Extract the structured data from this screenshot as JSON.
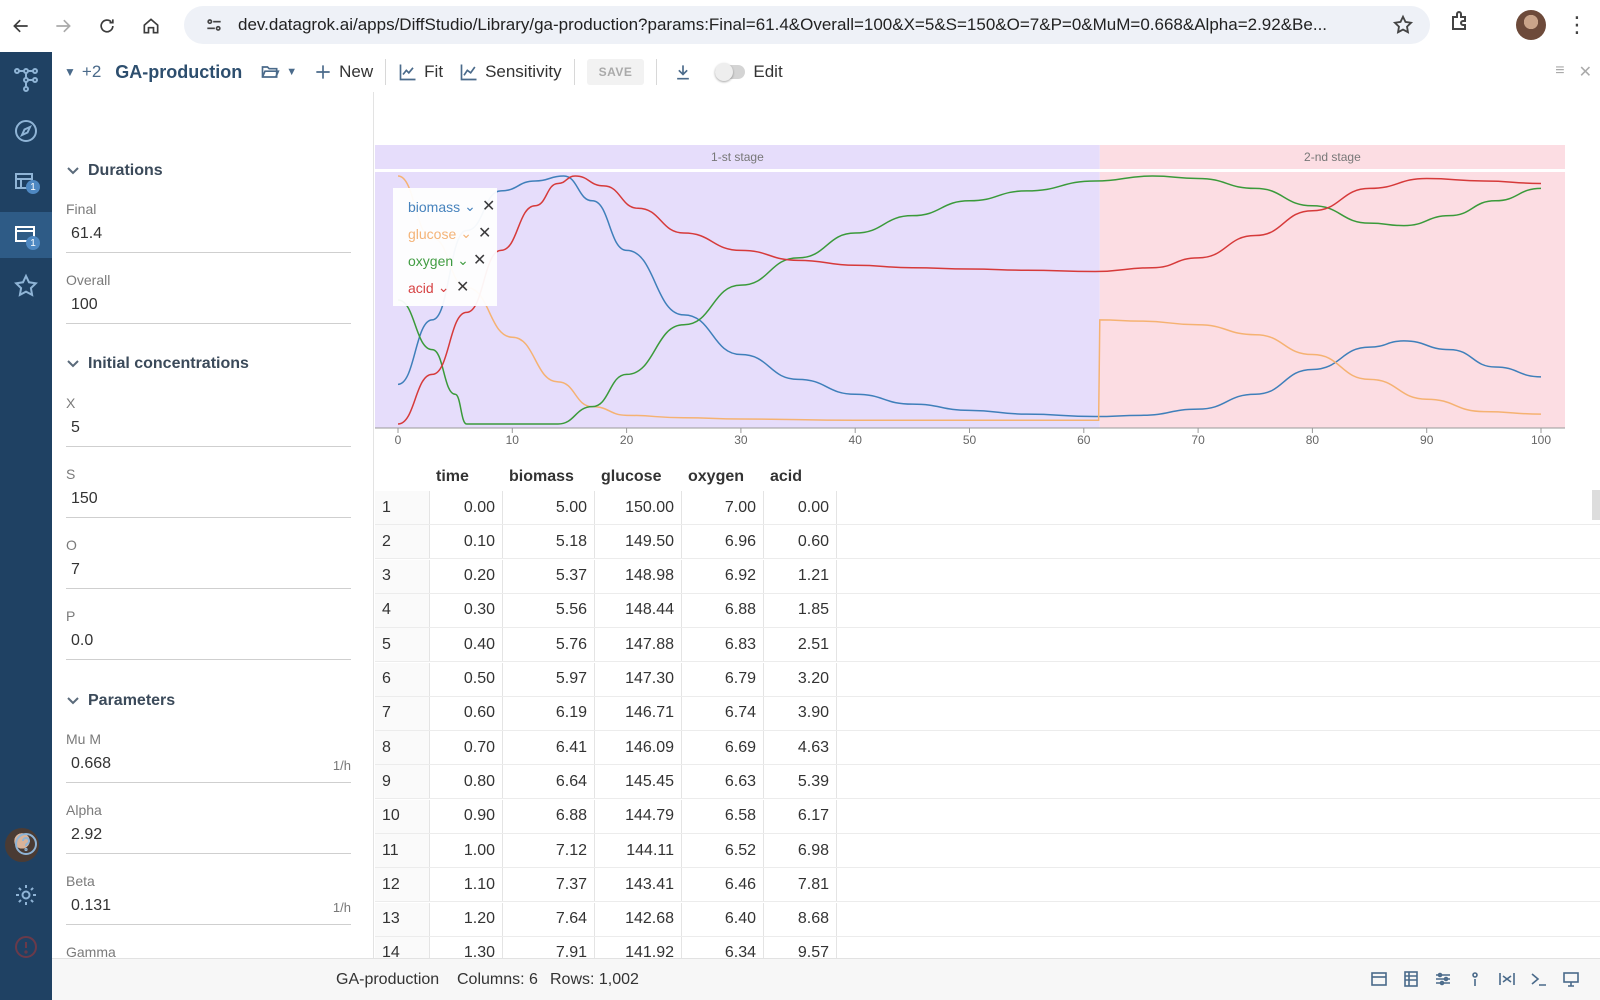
{
  "browser": {
    "url": "dev.datagrok.ai/apps/DiffStudio/Library/ga-production?params:Final=61.4&Overall=100&X=5&S=150&O=7&P=0&MuM=0.668&Alpha=2.92&Be..."
  },
  "toolbar": {
    "expand_count": "+2",
    "title": "GA-production",
    "new_label": "New",
    "fit_label": "Fit",
    "sensitivity_label": "Sensitivity",
    "save_label": "SAVE",
    "edit_label": "Edit"
  },
  "params": {
    "sections": {
      "durations": "Durations",
      "initial": "Initial concentrations",
      "parameters": "Parameters"
    },
    "fields": [
      {
        "label": "Final",
        "value": "61.4",
        "unit": ""
      },
      {
        "label": "Overall",
        "value": "100",
        "unit": ""
      },
      {
        "label": "X",
        "value": "5",
        "unit": ""
      },
      {
        "label": "S",
        "value": "150",
        "unit": ""
      },
      {
        "label": "O",
        "value": "7",
        "unit": ""
      },
      {
        "label": "P",
        "value": "0.0",
        "unit": ""
      },
      {
        "label": "Mu M",
        "value": "0.668",
        "unit": "1/h"
      },
      {
        "label": "Alpha",
        "value": "2.92",
        "unit": ""
      },
      {
        "label": "Beta",
        "value": "0.131",
        "unit": "1/h"
      },
      {
        "label": "Gamma",
        "value": "",
        "unit": ""
      }
    ]
  },
  "chart_data": {
    "type": "line",
    "xlim": [
      0,
      100
    ],
    "x_ticks": [
      "0",
      "10",
      "20",
      "30",
      "40",
      "50",
      "60",
      "70",
      "80",
      "90",
      "100"
    ],
    "stages": [
      {
        "label": "1-st stage",
        "from": 0,
        "to": 61.4,
        "color": "#e6ddfb"
      },
      {
        "label": "2-nd stage",
        "from": 61.4,
        "to": 100,
        "color": "#fcdde3"
      }
    ],
    "legend_position": "top-left",
    "series": [
      {
        "name": "biomass",
        "color": "#3f7fba",
        "points": [
          [
            0,
            0.84
          ],
          [
            3,
            0.58
          ],
          [
            6,
            0.22
          ],
          [
            9,
            0.06
          ],
          [
            12,
            0.02
          ],
          [
            14.5,
            0.0
          ],
          [
            17,
            0.1
          ],
          [
            20,
            0.3
          ],
          [
            25,
            0.56
          ],
          [
            30,
            0.72
          ],
          [
            35,
            0.82
          ],
          [
            40,
            0.88
          ],
          [
            45,
            0.92
          ],
          [
            50,
            0.945
          ],
          [
            55,
            0.96
          ],
          [
            61,
            0.97
          ],
          [
            65,
            0.965
          ],
          [
            70,
            0.94
          ],
          [
            75,
            0.88
          ],
          [
            80,
            0.78
          ],
          [
            85,
            0.69
          ],
          [
            88,
            0.665
          ],
          [
            92,
            0.7
          ],
          [
            96,
            0.77
          ],
          [
            100,
            0.81
          ]
        ]
      },
      {
        "name": "glucose",
        "color": "#f5b272",
        "points": [
          [
            0,
            0.0
          ],
          [
            3,
            0.25
          ],
          [
            6,
            0.45
          ],
          [
            10,
            0.65
          ],
          [
            14,
            0.83
          ],
          [
            17,
            0.93
          ],
          [
            20,
            0.965
          ],
          [
            25,
            0.975
          ],
          [
            30,
            0.98
          ],
          [
            40,
            0.985
          ],
          [
            50,
            0.985
          ],
          [
            61.3,
            0.985
          ],
          [
            61.4,
            0.58
          ],
          [
            65,
            0.585
          ],
          [
            70,
            0.6
          ],
          [
            75,
            0.64
          ],
          [
            80,
            0.72
          ],
          [
            85,
            0.82
          ],
          [
            90,
            0.9
          ],
          [
            95,
            0.95
          ],
          [
            100,
            0.96
          ]
        ]
      },
      {
        "name": "oxygen",
        "color": "#3a9a3a",
        "points": [
          [
            0,
            0.5
          ],
          [
            3,
            0.7
          ],
          [
            5,
            0.88
          ],
          [
            6,
            1.0
          ],
          [
            10,
            1.0
          ],
          [
            14,
            1.0
          ],
          [
            17,
            0.93
          ],
          [
            20,
            0.8
          ],
          [
            25,
            0.6
          ],
          [
            30,
            0.44
          ],
          [
            35,
            0.33
          ],
          [
            40,
            0.23
          ],
          [
            45,
            0.16
          ],
          [
            50,
            0.1
          ],
          [
            55,
            0.06
          ],
          [
            61,
            0.02
          ],
          [
            66,
            0.0
          ],
          [
            70,
            0.01
          ],
          [
            75,
            0.05
          ],
          [
            80,
            0.12
          ],
          [
            85,
            0.19
          ],
          [
            88,
            0.2
          ],
          [
            92,
            0.16
          ],
          [
            96,
            0.1
          ],
          [
            100,
            0.05
          ]
        ]
      },
      {
        "name": "acid",
        "color": "#d63a3a",
        "points": [
          [
            0,
            1.0
          ],
          [
            3,
            0.8
          ],
          [
            6,
            0.55
          ],
          [
            9,
            0.3
          ],
          [
            12,
            0.12
          ],
          [
            14,
            0.03
          ],
          [
            15.5,
            0.0
          ],
          [
            18,
            0.04
          ],
          [
            21,
            0.13
          ],
          [
            25,
            0.23
          ],
          [
            30,
            0.3
          ],
          [
            35,
            0.34
          ],
          [
            40,
            0.36
          ],
          [
            45,
            0.37
          ],
          [
            50,
            0.375
          ],
          [
            55,
            0.38
          ],
          [
            61,
            0.385
          ],
          [
            66,
            0.37
          ],
          [
            70,
            0.33
          ],
          [
            75,
            0.24
          ],
          [
            80,
            0.14
          ],
          [
            85,
            0.05
          ],
          [
            90,
            0.01
          ],
          [
            95,
            0.02
          ],
          [
            100,
            0.03
          ]
        ]
      }
    ]
  },
  "table": {
    "columns": [
      "time",
      "biomass",
      "glucose",
      "oxygen",
      "acid"
    ],
    "rows": [
      [
        "1",
        "0.00",
        "5.00",
        "150.00",
        "7.00",
        "0.00"
      ],
      [
        "2",
        "0.10",
        "5.18",
        "149.50",
        "6.96",
        "0.60"
      ],
      [
        "3",
        "0.20",
        "5.37",
        "148.98",
        "6.92",
        "1.21"
      ],
      [
        "4",
        "0.30",
        "5.56",
        "148.44",
        "6.88",
        "1.85"
      ],
      [
        "5",
        "0.40",
        "5.76",
        "147.88",
        "6.83",
        "2.51"
      ],
      [
        "6",
        "0.50",
        "5.97",
        "147.30",
        "6.79",
        "3.20"
      ],
      [
        "7",
        "0.60",
        "6.19",
        "146.71",
        "6.74",
        "3.90"
      ],
      [
        "8",
        "0.70",
        "6.41",
        "146.09",
        "6.69",
        "4.63"
      ],
      [
        "9",
        "0.80",
        "6.64",
        "145.45",
        "6.63",
        "5.39"
      ],
      [
        "10",
        "0.90",
        "6.88",
        "144.79",
        "6.58",
        "6.17"
      ],
      [
        "11",
        "1.00",
        "7.12",
        "144.11",
        "6.52",
        "6.98"
      ],
      [
        "12",
        "1.10",
        "7.37",
        "143.41",
        "6.46",
        "7.81"
      ],
      [
        "13",
        "1.20",
        "7.64",
        "142.68",
        "6.40",
        "8.68"
      ],
      [
        "14",
        "1.30",
        "7.91",
        "141.92",
        "6.34",
        "9.57"
      ]
    ]
  },
  "status": {
    "name": "GA-production",
    "columns": "Columns: 6",
    "rows": "Rows: 1,002"
  }
}
